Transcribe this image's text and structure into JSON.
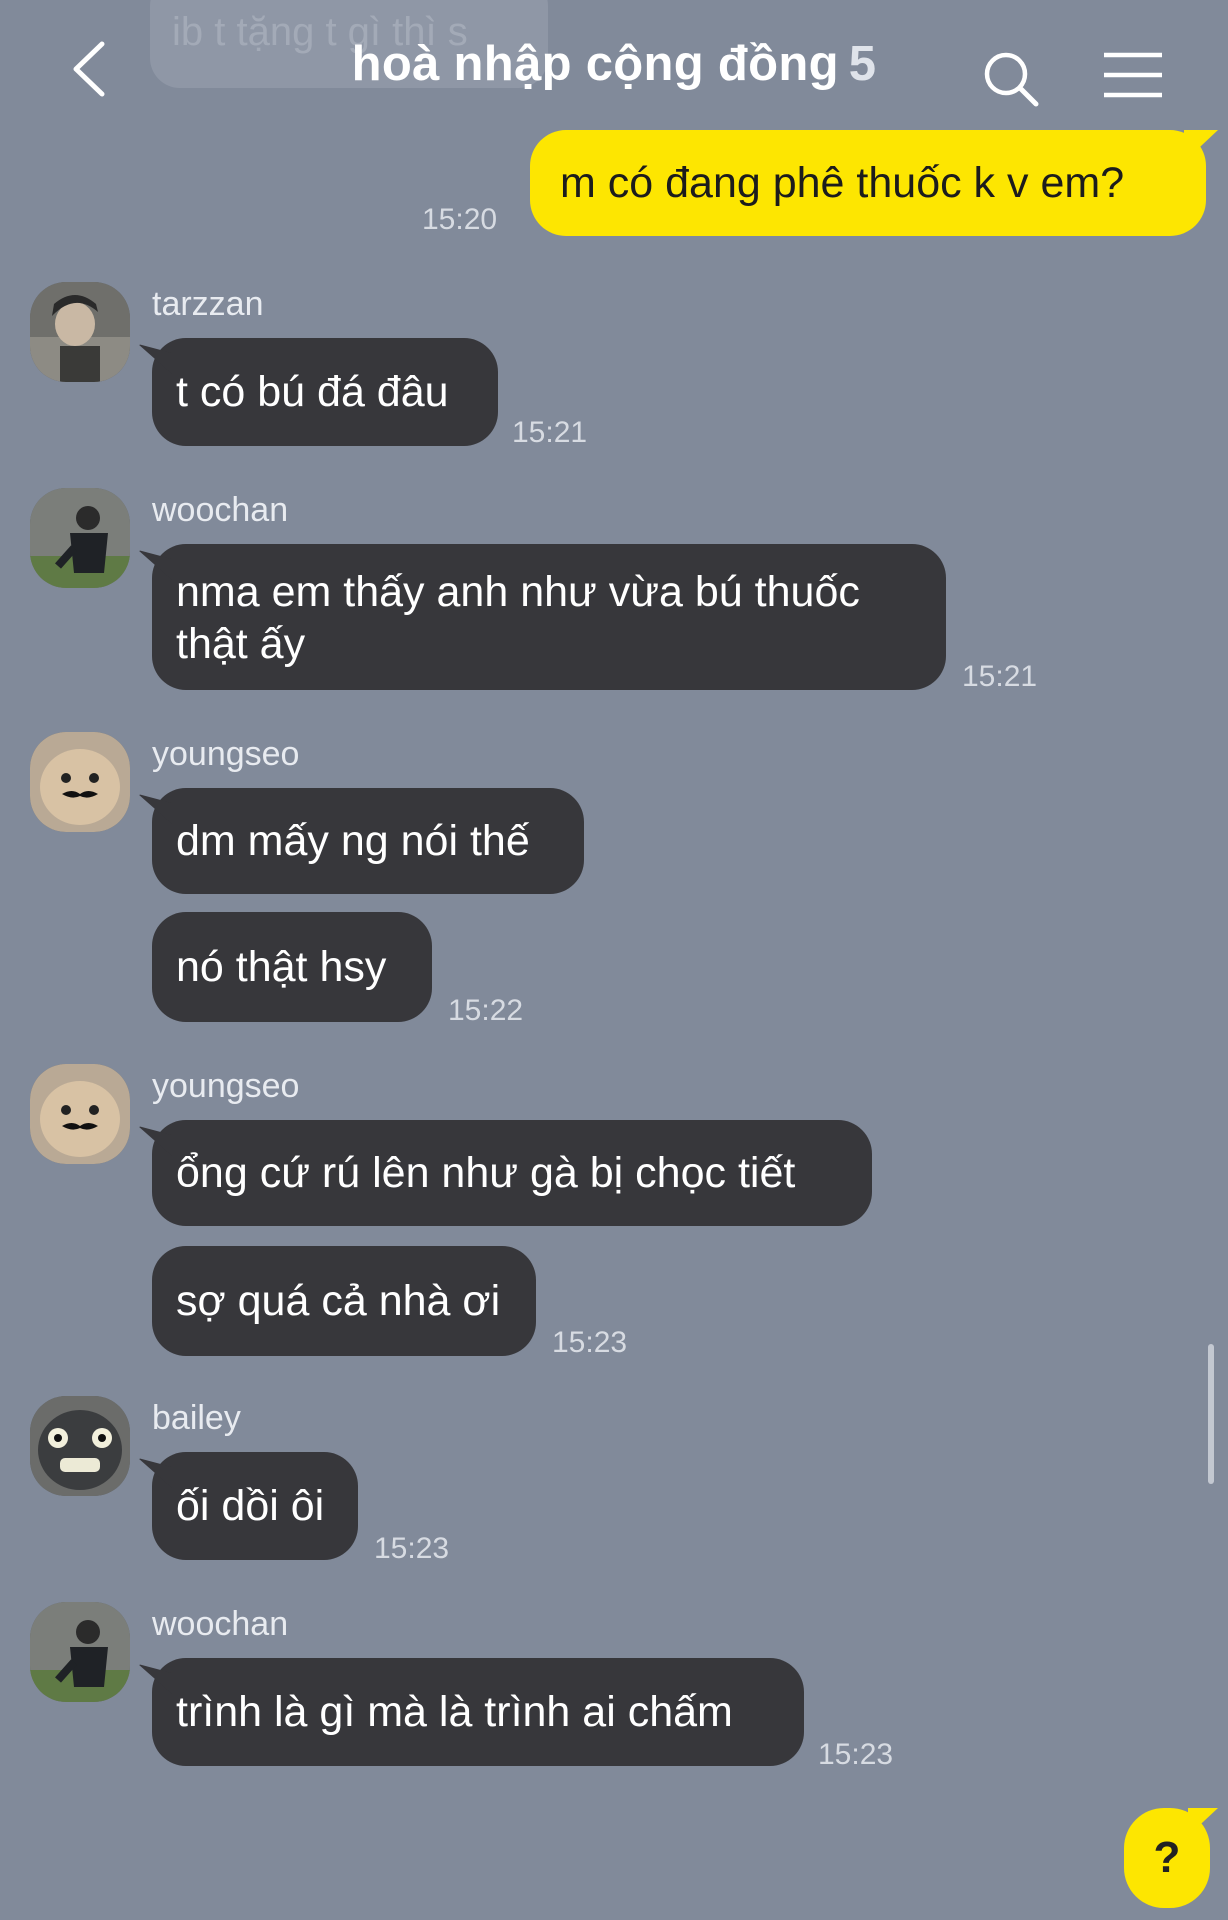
{
  "header": {
    "title": "hoà nhập cộng đồng",
    "member_count": "5",
    "back_icon": "chevron-left-icon",
    "search_icon": "search-icon",
    "menu_icon": "hamburger-menu-icon"
  },
  "ghost_message": "ib t tặng t gì thì s",
  "colors": {
    "background": "#818a9a",
    "my_bubble": "#fde601",
    "other_bubble": "#37373b"
  },
  "messages": [
    {
      "sender": "me",
      "text": "m có đang phê thuốc k v em?",
      "time": "15:20"
    },
    {
      "sender": "tarzzan",
      "text": "t có bú đá đâu",
      "time": "15:21"
    },
    {
      "sender": "woochan",
      "text": "nma em thấy anh như vừa bú thuốc thật ấy",
      "time": "15:21"
    },
    {
      "sender": "youngseo",
      "texts": [
        "dm mấy ng nói thế",
        "nó thật hsy"
      ],
      "time": "15:22"
    },
    {
      "sender": "youngseo",
      "texts": [
        "ổng cứ rú lên như gà bị chọc tiết",
        "sợ quá cả nhà ơi"
      ],
      "time": "15:23"
    },
    {
      "sender": "bailey",
      "text": "ối dồi ôi",
      "time": "15:23"
    },
    {
      "sender": "woochan",
      "text": "trình là gì mà là trình ai chấm",
      "time": "15:23"
    }
  ],
  "help_button": "?"
}
